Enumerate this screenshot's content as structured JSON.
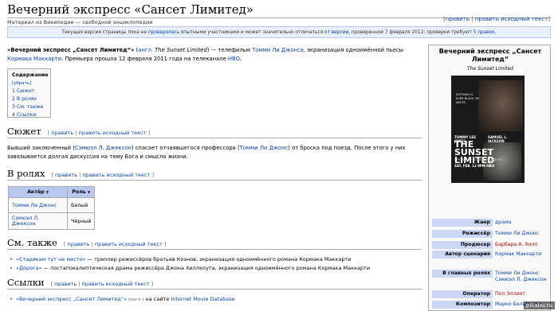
{
  "header": {
    "title": "Вечерний экспресс «Сансет Лимитед»",
    "subtitle": "Материал из Википедии — свободной энциклопедии",
    "edit_open": "[",
    "edit": "править",
    "edit_sep": " | ",
    "edit_source": "править исходный текст",
    "edit_close": "]"
  },
  "notice": {
    "part1": "Текущая версия страницы пока не ",
    "link1": "проверялась",
    "part2": " опытными участниками и может значительно отличаться от ",
    "link2": "версии",
    "part3": ", проверенной 7 февраля 2012; проверки требуют ",
    "link3": "5 правок",
    "part4": "."
  },
  "intro": {
    "bold": "«Вечерний экспресс „Сансет Лимитед“»",
    "p1": " (",
    "lang": "англ.",
    "orig": " The Sunset Limited",
    "p2": ") — телефильм ",
    "director": "Томми Ли Джонса",
    "p3": ", экранизация одноимённой пьесы ",
    "author": "Кормака Маккарти",
    "p4": ". Премьера прошла 12 февраля 2011 года на телеканале ",
    "channel": "HBO",
    "p5": "."
  },
  "toc": {
    "heading": "Содержание",
    "hide": "[убрать]",
    "items": [
      "1 Сюжет",
      "2 В ролях",
      "3 См. также",
      "4 Ссылки"
    ]
  },
  "sections": {
    "plot": {
      "heading": "Сюжет",
      "text1": "Бывший заключенный (",
      "link1": "Сэмюэл Л. Джексон",
      "text2": ") спасает отчаявшегося профессора (",
      "link2": "Томми Ли Джонс",
      "text3": ") от броска под поезд. После этого у них завязывается долгая дискуссия на тему Бога и смысла жизни."
    },
    "cast": {
      "heading": "В ролях",
      "columns": [
        "Актёр",
        "Роль"
      ],
      "rows": [
        {
          "actor": "Томми Ли Джонс",
          "role": "Белый"
        },
        {
          "actor": "Сэмюэл Л. Джексон",
          "role": "Чёрный"
        }
      ],
      "sort_mark": "▼"
    },
    "see_also": {
      "heading": "См. также",
      "items": [
        {
          "link": "«Старикам тут не место»",
          "text": " — триллер режиссёров братьев Коэнов, экранизация одноимённого романа Кормака Маккарти"
        },
        {
          "link": "«Дорога»",
          "text": " — постапокалиптическая драма режиссёра Джона Хиллкоута, экранизация одноимённого романа Кормака Маккарти"
        }
      ]
    },
    "links": {
      "heading": "Ссылки",
      "link": "«Вечерний экспресс „Сансет Лимитед“»",
      "lang": " (англ.)",
      "text": " на сайте ",
      "site": "Internet Movie Database"
    }
  },
  "infobox": {
    "title": "Вечерний экспресс „Сансет Лимитед“",
    "subtitle": "The Sunset Limited",
    "poster": {
      "tagline": "NOTHING IS EVER BLACK OR WHITE.",
      "actor1": "TOMMY LEE JONES",
      "actor2": "SAMUEL L. JACKSON",
      "title": "THE SUNSET LIMITED",
      "credit": "WRITTEN BY CORMAC MCCARTHY",
      "date": "SAT, FEB. 12 9PM HBO"
    },
    "rows": [
      {
        "label": "Жанр",
        "value": "драма"
      },
      {
        "label": "Режиссёр",
        "value": "Томми Ли Джонс"
      },
      {
        "label": "Продюсер",
        "value": "Барбара А. Холл"
      },
      {
        "label": "Автор сценария",
        "value": "Кормак Маккарти"
      },
      {
        "label": "В главных ролях",
        "value1": "Томми Ли Джонс",
        "value2": "Сэмюэл Л. Джексон"
      },
      {
        "label": "Оператор",
        "value": "Пол Эллиот"
      },
      {
        "label": "Композитор",
        "value": "Марко Бельтрами"
      }
    ]
  },
  "watermark": "pikabu.ru",
  "colors": {
    "link": "#0645ad",
    "redlink": "#ba0000",
    "infobox_label": "#ccd6f5"
  }
}
